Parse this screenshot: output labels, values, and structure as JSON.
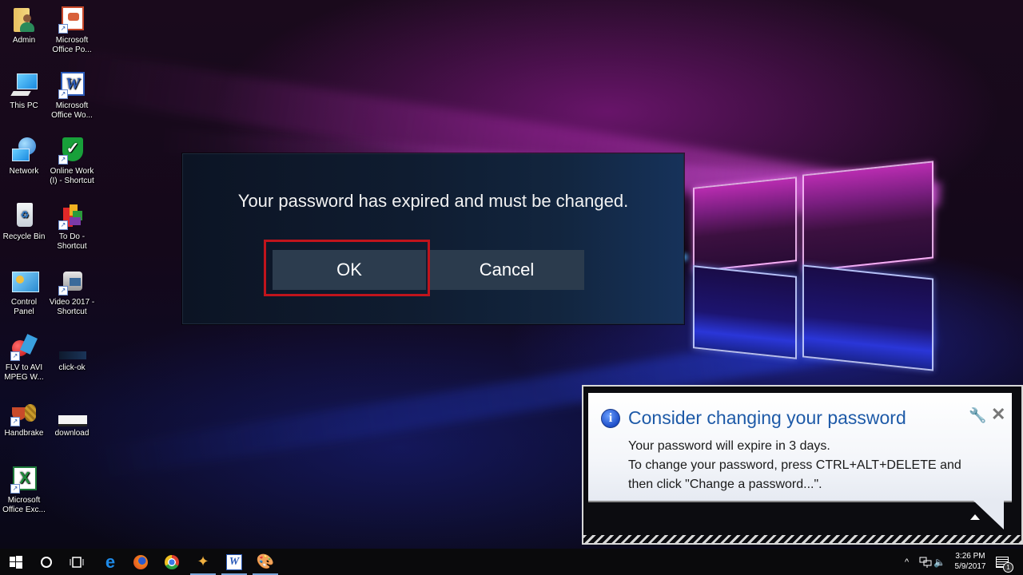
{
  "desktop": {
    "icons": [
      {
        "label": "Admin",
        "icon": "user-folder-icon",
        "shortcut": false
      },
      {
        "label": "Microsoft Office Po...",
        "icon": "powerpoint-icon",
        "shortcut": true
      },
      {
        "label": "This PC",
        "icon": "computer-icon",
        "shortcut": false
      },
      {
        "label": "Microsoft Office Wo...",
        "icon": "word-icon",
        "shortcut": true
      },
      {
        "label": "Network",
        "icon": "network-icon",
        "shortcut": false
      },
      {
        "label": "Online Work (I) - Shortcut",
        "icon": "shield-check-icon",
        "shortcut": true
      },
      {
        "label": "Recycle Bin",
        "icon": "recycle-bin-icon",
        "shortcut": false
      },
      {
        "label": "To Do - Shortcut",
        "icon": "todo-app-icon",
        "shortcut": true
      },
      {
        "label": "Control Panel",
        "icon": "control-panel-icon",
        "shortcut": false
      },
      {
        "label": "Video 2017 - Shortcut",
        "icon": "camcorder-icon",
        "shortcut": true
      },
      {
        "label": "FLV to AVI MPEG W...",
        "icon": "video-converter-icon",
        "shortcut": true
      },
      {
        "label": "click-ok",
        "icon": "image-thumbnail-icon",
        "shortcut": false
      },
      {
        "label": "Handbrake",
        "icon": "handbrake-icon",
        "shortcut": true
      },
      {
        "label": "download",
        "icon": "image-thumbnail-icon",
        "shortcut": false
      },
      {
        "label": "Microsoft Office Exc...",
        "icon": "excel-icon",
        "shortcut": true
      }
    ]
  },
  "dialog": {
    "message": "Your password has expired and must be changed.",
    "ok_label": "OK",
    "cancel_label": "Cancel",
    "highlight_color": "#c0141c"
  },
  "notification": {
    "title": "Consider changing your password",
    "line1": "Your password will expire in 3 days.",
    "line2": "To change your password, press CTRL+ALT+DELETE and",
    "line3": "then click \"Change a password...\".",
    "info_glyph": "i",
    "close_glyph": "✕",
    "settings_glyph": "🔧"
  },
  "taskbar": {
    "items": [
      {
        "name": "start-button",
        "icon": "windows-logo-icon"
      },
      {
        "name": "cortana-button",
        "icon": "search-circle-icon"
      },
      {
        "name": "task-view-button",
        "icon": "task-view-icon"
      },
      {
        "name": "edge-button",
        "icon": "edge-icon"
      },
      {
        "name": "firefox-button",
        "icon": "firefox-icon"
      },
      {
        "name": "chrome-button",
        "icon": "chrome-icon"
      },
      {
        "name": "app-button",
        "icon": "star-app-icon",
        "active": true
      },
      {
        "name": "word-button",
        "icon": "word-icon",
        "active": true
      },
      {
        "name": "paint-button",
        "icon": "paint-icon",
        "active": true
      }
    ],
    "tray": {
      "chevron": "^",
      "time": "3:26 PM",
      "date": "5/9/2017",
      "notification_count": "1"
    }
  }
}
